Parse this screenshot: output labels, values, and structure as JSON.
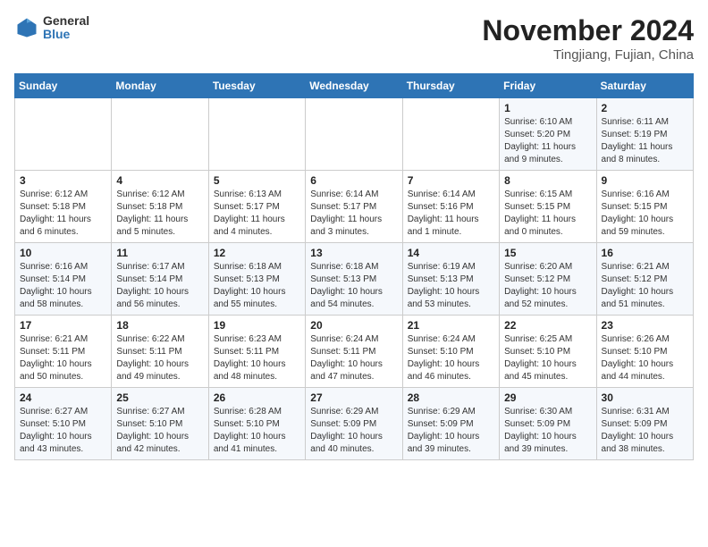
{
  "logo": {
    "line1": "General",
    "line2": "Blue"
  },
  "title": "November 2024",
  "subtitle": "Tingjiang, Fujian, China",
  "weekdays": [
    "Sunday",
    "Monday",
    "Tuesday",
    "Wednesday",
    "Thursday",
    "Friday",
    "Saturday"
  ],
  "weeks": [
    [
      {
        "day": "",
        "info": ""
      },
      {
        "day": "",
        "info": ""
      },
      {
        "day": "",
        "info": ""
      },
      {
        "day": "",
        "info": ""
      },
      {
        "day": "",
        "info": ""
      },
      {
        "day": "1",
        "info": "Sunrise: 6:10 AM\nSunset: 5:20 PM\nDaylight: 11 hours and 9 minutes."
      },
      {
        "day": "2",
        "info": "Sunrise: 6:11 AM\nSunset: 5:19 PM\nDaylight: 11 hours and 8 minutes."
      }
    ],
    [
      {
        "day": "3",
        "info": "Sunrise: 6:12 AM\nSunset: 5:18 PM\nDaylight: 11 hours and 6 minutes."
      },
      {
        "day": "4",
        "info": "Sunrise: 6:12 AM\nSunset: 5:18 PM\nDaylight: 11 hours and 5 minutes."
      },
      {
        "day": "5",
        "info": "Sunrise: 6:13 AM\nSunset: 5:17 PM\nDaylight: 11 hours and 4 minutes."
      },
      {
        "day": "6",
        "info": "Sunrise: 6:14 AM\nSunset: 5:17 PM\nDaylight: 11 hours and 3 minutes."
      },
      {
        "day": "7",
        "info": "Sunrise: 6:14 AM\nSunset: 5:16 PM\nDaylight: 11 hours and 1 minute."
      },
      {
        "day": "8",
        "info": "Sunrise: 6:15 AM\nSunset: 5:15 PM\nDaylight: 11 hours and 0 minutes."
      },
      {
        "day": "9",
        "info": "Sunrise: 6:16 AM\nSunset: 5:15 PM\nDaylight: 10 hours and 59 minutes."
      }
    ],
    [
      {
        "day": "10",
        "info": "Sunrise: 6:16 AM\nSunset: 5:14 PM\nDaylight: 10 hours and 58 minutes."
      },
      {
        "day": "11",
        "info": "Sunrise: 6:17 AM\nSunset: 5:14 PM\nDaylight: 10 hours and 56 minutes."
      },
      {
        "day": "12",
        "info": "Sunrise: 6:18 AM\nSunset: 5:13 PM\nDaylight: 10 hours and 55 minutes."
      },
      {
        "day": "13",
        "info": "Sunrise: 6:18 AM\nSunset: 5:13 PM\nDaylight: 10 hours and 54 minutes."
      },
      {
        "day": "14",
        "info": "Sunrise: 6:19 AM\nSunset: 5:13 PM\nDaylight: 10 hours and 53 minutes."
      },
      {
        "day": "15",
        "info": "Sunrise: 6:20 AM\nSunset: 5:12 PM\nDaylight: 10 hours and 52 minutes."
      },
      {
        "day": "16",
        "info": "Sunrise: 6:21 AM\nSunset: 5:12 PM\nDaylight: 10 hours and 51 minutes."
      }
    ],
    [
      {
        "day": "17",
        "info": "Sunrise: 6:21 AM\nSunset: 5:11 PM\nDaylight: 10 hours and 50 minutes."
      },
      {
        "day": "18",
        "info": "Sunrise: 6:22 AM\nSunset: 5:11 PM\nDaylight: 10 hours and 49 minutes."
      },
      {
        "day": "19",
        "info": "Sunrise: 6:23 AM\nSunset: 5:11 PM\nDaylight: 10 hours and 48 minutes."
      },
      {
        "day": "20",
        "info": "Sunrise: 6:24 AM\nSunset: 5:11 PM\nDaylight: 10 hours and 47 minutes."
      },
      {
        "day": "21",
        "info": "Sunrise: 6:24 AM\nSunset: 5:10 PM\nDaylight: 10 hours and 46 minutes."
      },
      {
        "day": "22",
        "info": "Sunrise: 6:25 AM\nSunset: 5:10 PM\nDaylight: 10 hours and 45 minutes."
      },
      {
        "day": "23",
        "info": "Sunrise: 6:26 AM\nSunset: 5:10 PM\nDaylight: 10 hours and 44 minutes."
      }
    ],
    [
      {
        "day": "24",
        "info": "Sunrise: 6:27 AM\nSunset: 5:10 PM\nDaylight: 10 hours and 43 minutes."
      },
      {
        "day": "25",
        "info": "Sunrise: 6:27 AM\nSunset: 5:10 PM\nDaylight: 10 hours and 42 minutes."
      },
      {
        "day": "26",
        "info": "Sunrise: 6:28 AM\nSunset: 5:10 PM\nDaylight: 10 hours and 41 minutes."
      },
      {
        "day": "27",
        "info": "Sunrise: 6:29 AM\nSunset: 5:09 PM\nDaylight: 10 hours and 40 minutes."
      },
      {
        "day": "28",
        "info": "Sunrise: 6:29 AM\nSunset: 5:09 PM\nDaylight: 10 hours and 39 minutes."
      },
      {
        "day": "29",
        "info": "Sunrise: 6:30 AM\nSunset: 5:09 PM\nDaylight: 10 hours and 39 minutes."
      },
      {
        "day": "30",
        "info": "Sunrise: 6:31 AM\nSunset: 5:09 PM\nDaylight: 10 hours and 38 minutes."
      }
    ]
  ]
}
